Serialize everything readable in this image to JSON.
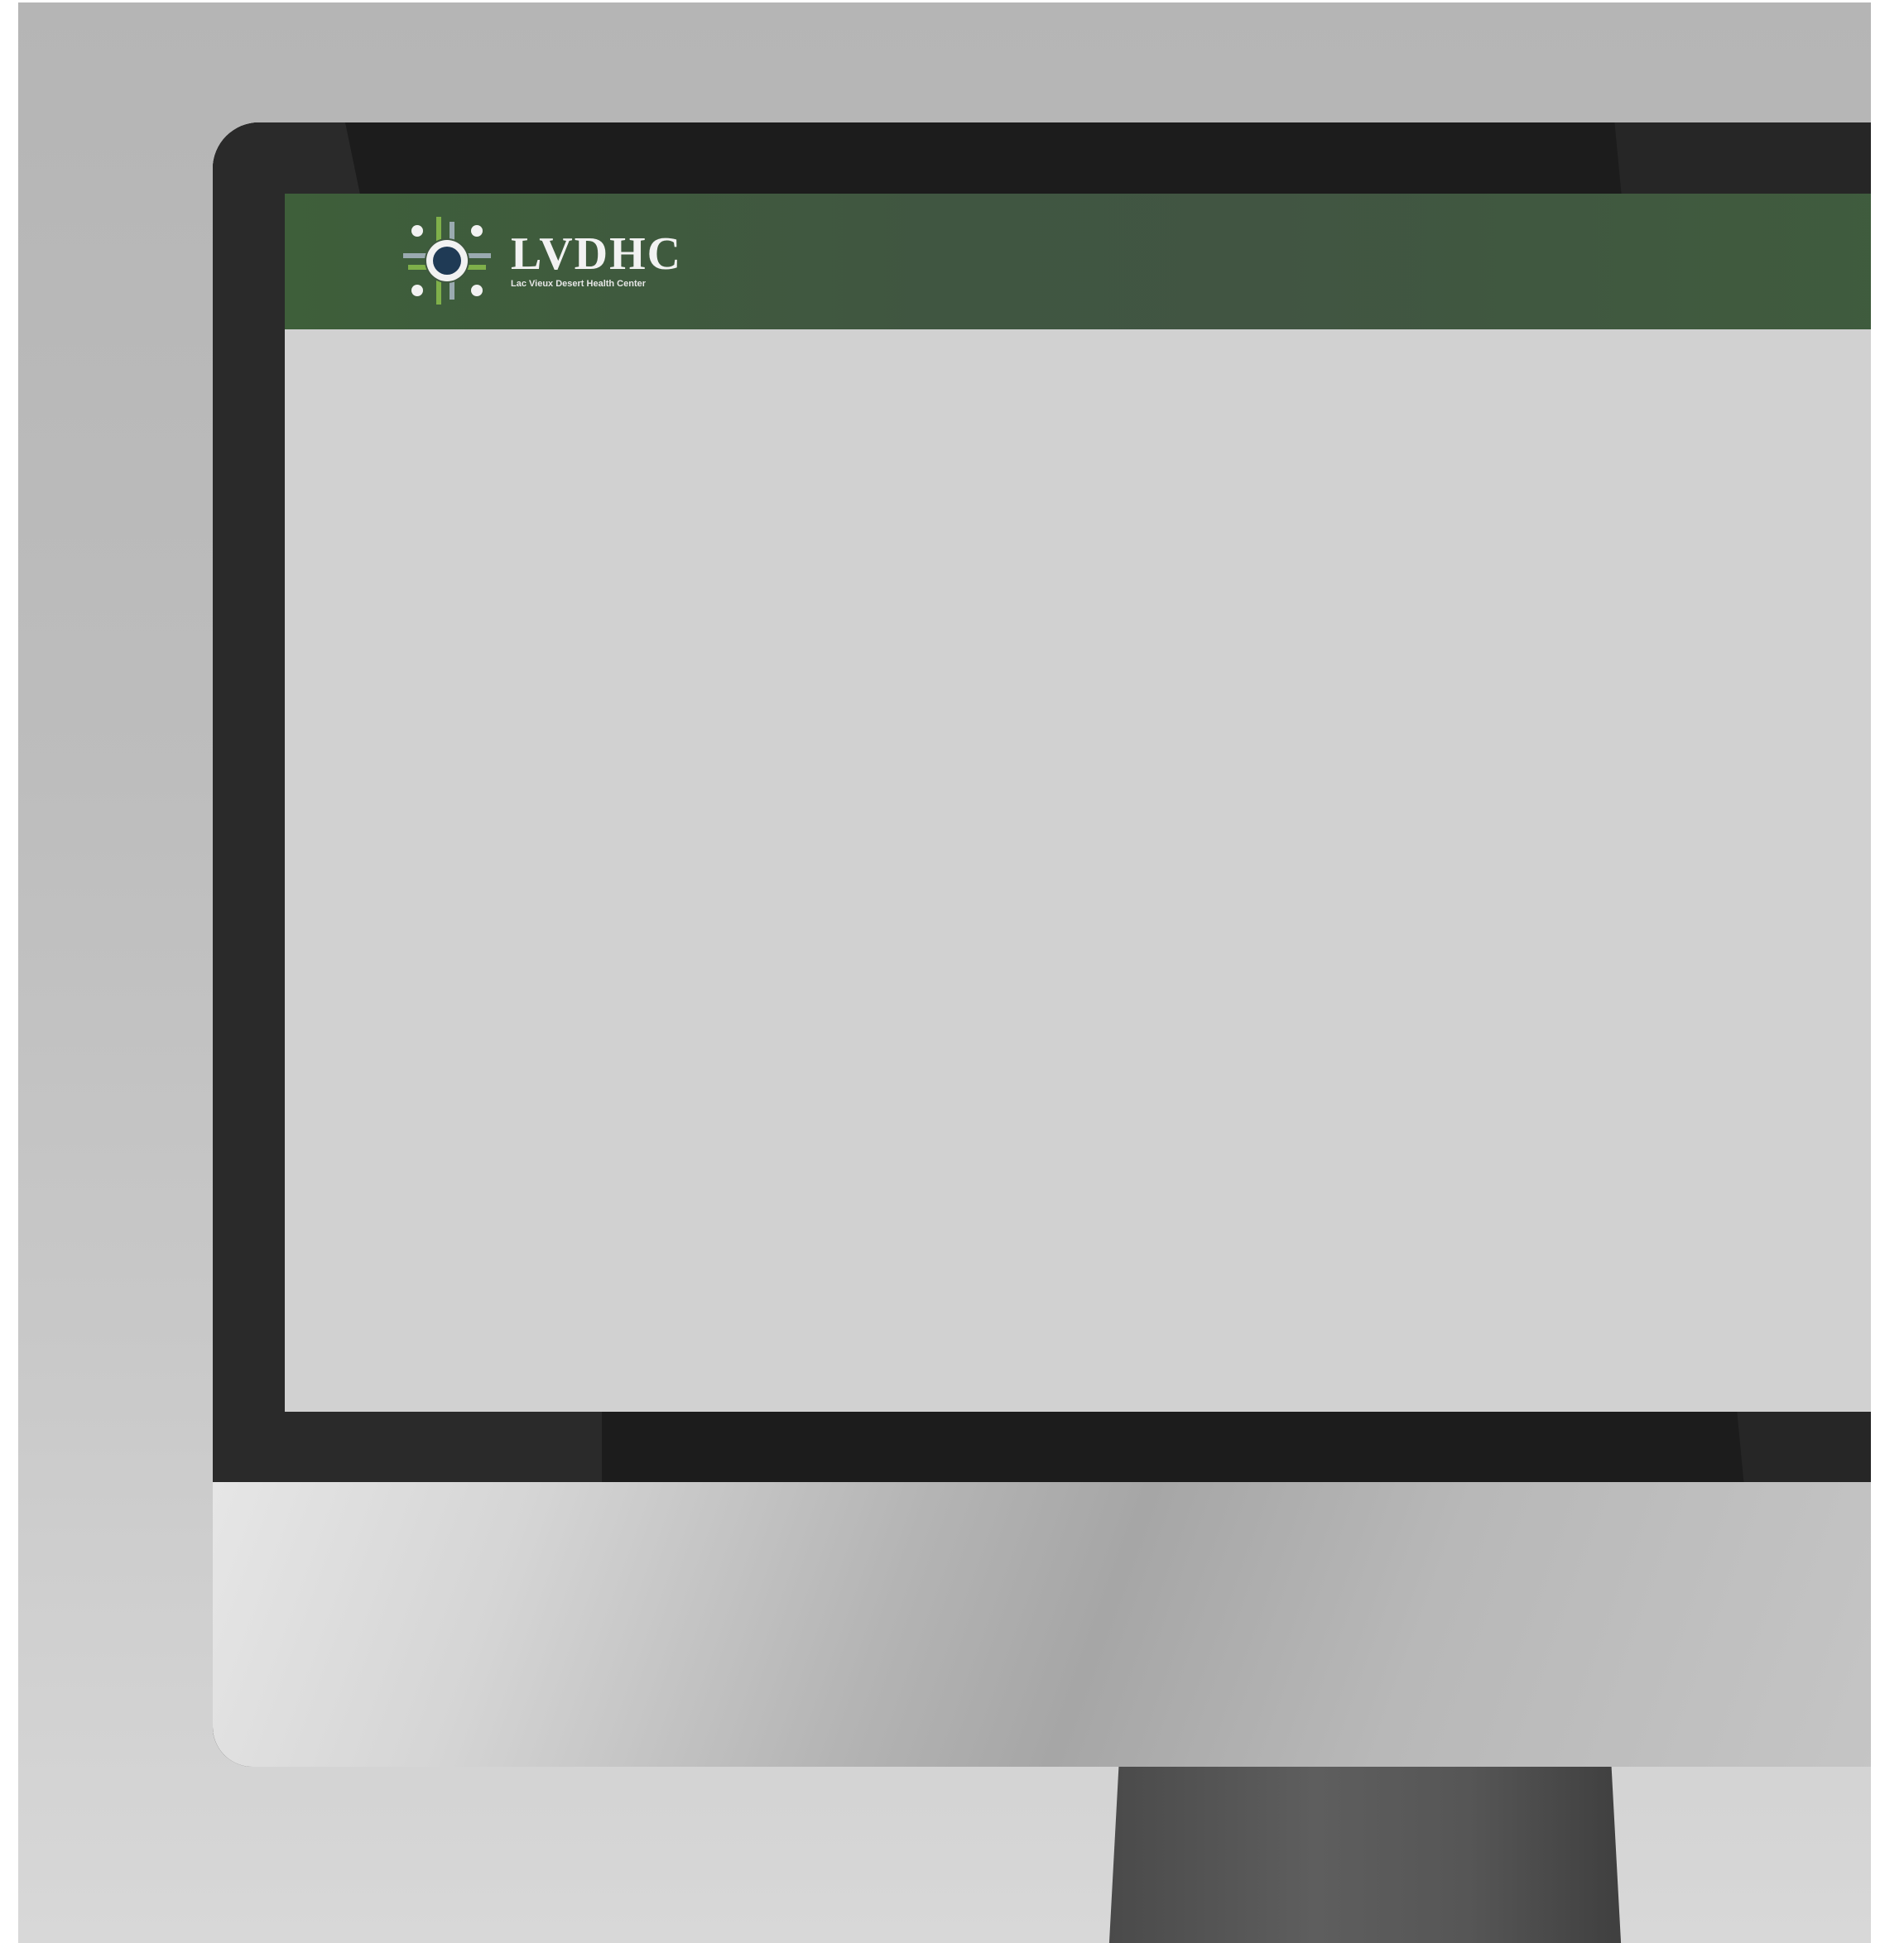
{
  "app": {
    "brand_title": "LVDHC",
    "brand_subtitle": "Lac Vieux Desert Health Center"
  },
  "icons": {
    "logo": "sun-cross-logo-icon"
  },
  "colors": {
    "header_green": "#405641",
    "screen_background": "#d1d1d1",
    "logo_light_green": "#7fb04a",
    "logo_gray_blue": "#9aaab0",
    "logo_navy": "#1f3a55"
  }
}
